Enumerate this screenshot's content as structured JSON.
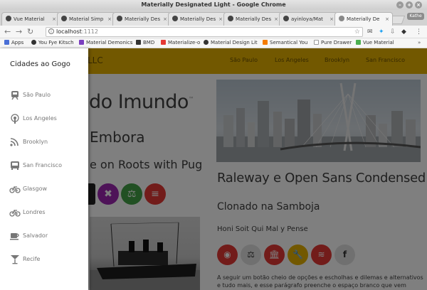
{
  "window": {
    "title": "Materially Designated Light - Google Chrome",
    "user_badge": "Kathe"
  },
  "tabs": [
    {
      "label": "Vue Material"
    },
    {
      "label": "Material Simp"
    },
    {
      "label": "Materially Des"
    },
    {
      "label": "Materially Des"
    },
    {
      "label": "Materially Des"
    },
    {
      "label": "ayinloya/Mat"
    },
    {
      "label": "Materially De",
      "active": true
    }
  ],
  "address": {
    "host": "localhost",
    "port": ":1112"
  },
  "bookmarks": [
    {
      "label": "Apps",
      "color": "#4a6fd6"
    },
    {
      "label": "You Fye Kitsch",
      "color": "#333"
    },
    {
      "label": "Material Demonics",
      "color": "#7b3fbf"
    },
    {
      "label": "BMD",
      "color": "#333"
    },
    {
      "label": "Materialize-o",
      "color": "#e53935"
    },
    {
      "label": "Material Design Lit",
      "color": "#333"
    },
    {
      "label": "Semantical You",
      "color": "#f57c00"
    },
    {
      "label": "Pure Drawer",
      "color": "#777"
    },
    {
      "label": "Vue Material",
      "color": "#4caf50"
    }
  ],
  "navbar": {
    "brand": "LLC",
    "links": [
      "São Paulo",
      "Los Angeles",
      "Brooklyn",
      "San Francisco"
    ],
    "color": "#e5b100"
  },
  "hero": {
    "title": "do Imundo",
    "title_sup": "™",
    "subtitle": "Embora",
    "subtitle2": "e on Roots with Pug"
  },
  "left_buttons": [
    {
      "icon": "close-icon",
      "glyph": "✖",
      "color": "#9c27b0"
    },
    {
      "icon": "balance-icon",
      "glyph": "⚖",
      "color": "#43a047"
    },
    {
      "icon": "menu-icon",
      "glyph": "≡",
      "color": "#e53935"
    }
  ],
  "right": {
    "title": "Raleway e Open Sans Condensed",
    "subtitle": "Clonado na Samboja",
    "small": "Honi Soit Qui Mal y Pense",
    "paragraph": "A seguir um botão cheio de opções e escholhas e dilemas e alternativos e tudo mais, e esse parágrafo preenche o espaço branco que vem antes."
  },
  "right_buttons": [
    {
      "icon": "github-icon",
      "glyph": "◉",
      "color": "#e53935"
    },
    {
      "icon": "balance-icon",
      "glyph": "⚖",
      "color": "#e0e0e0"
    },
    {
      "icon": "bank-icon",
      "glyph": "🏛",
      "color": "#e53935"
    },
    {
      "icon": "wrench-icon",
      "glyph": "🔧",
      "color": "#e5b100"
    },
    {
      "icon": "wifi-icon",
      "glyph": "≋",
      "color": "#e53935"
    },
    {
      "icon": "facebook-icon",
      "glyph": "f",
      "color": "#e0e0e0"
    }
  ],
  "drawer": {
    "title": "Cidades ao Gogo",
    "items": [
      {
        "label": "São Paulo",
        "icon": "subway-icon"
      },
      {
        "label": "Los Angeles",
        "icon": "podcast-icon"
      },
      {
        "label": "Brooklyn",
        "icon": "rss-icon"
      },
      {
        "label": "San Francisco",
        "icon": "bus-icon"
      },
      {
        "label": "Glasgow",
        "icon": "bicycle-icon"
      },
      {
        "label": "Londres",
        "icon": "bicycle-icon"
      },
      {
        "label": "Salvador",
        "icon": "coffee-icon"
      },
      {
        "label": "Recife",
        "icon": "cocktail-icon"
      }
    ]
  }
}
